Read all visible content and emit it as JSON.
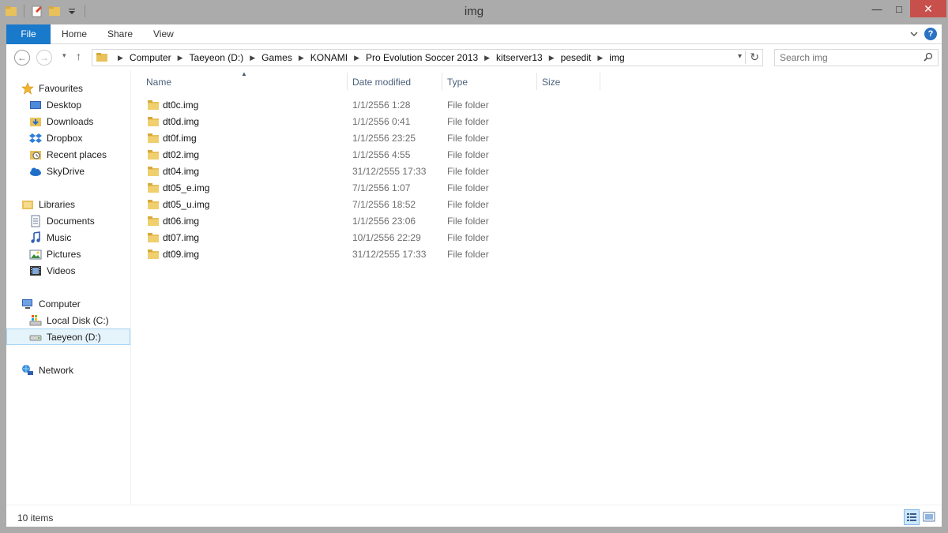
{
  "window": {
    "title": "img",
    "buttons": {
      "minimize": "—",
      "maximize": "□",
      "close": "✕"
    }
  },
  "ribbon": {
    "tabs": [
      "File",
      "Home",
      "Share",
      "View"
    ],
    "help": "?"
  },
  "address": {
    "crumbs": [
      "Computer",
      "Taeyeon (D:)",
      "Games",
      "KONAMI",
      "Pro Evolution Soccer 2013",
      "kitserver13",
      "pesedit",
      "img"
    ]
  },
  "search": {
    "placeholder": "Search img"
  },
  "nav": {
    "favourites": {
      "label": "Favourites",
      "items": [
        "Desktop",
        "Downloads",
        "Dropbox",
        "Recent places",
        "SkyDrive"
      ]
    },
    "libraries": {
      "label": "Libraries",
      "items": [
        "Documents",
        "Music",
        "Pictures",
        "Videos"
      ]
    },
    "computer": {
      "label": "Computer",
      "items": [
        "Local Disk (C:)",
        "Taeyeon (D:)"
      ],
      "selected": "Taeyeon (D:)"
    },
    "network": {
      "label": "Network"
    }
  },
  "columns": {
    "name": "Name",
    "date": "Date modified",
    "type": "Type",
    "size": "Size"
  },
  "files": [
    {
      "name": "dt0c.img",
      "date": "1/1/2556 1:28",
      "type": "File folder",
      "size": ""
    },
    {
      "name": "dt0d.img",
      "date": "1/1/2556 0:41",
      "type": "File folder",
      "size": ""
    },
    {
      "name": "dt0f.img",
      "date": "1/1/2556 23:25",
      "type": "File folder",
      "size": ""
    },
    {
      "name": "dt02.img",
      "date": "1/1/2556 4:55",
      "type": "File folder",
      "size": ""
    },
    {
      "name": "dt04.img",
      "date": "31/12/2555 17:33",
      "type": "File folder",
      "size": ""
    },
    {
      "name": "dt05_e.img",
      "date": "7/1/2556 1:07",
      "type": "File folder",
      "size": ""
    },
    {
      "name": "dt05_u.img",
      "date": "7/1/2556 18:52",
      "type": "File folder",
      "size": ""
    },
    {
      "name": "dt06.img",
      "date": "1/1/2556 23:06",
      "type": "File folder",
      "size": ""
    },
    {
      "name": "dt07.img",
      "date": "10/1/2556 22:29",
      "type": "File folder",
      "size": ""
    },
    {
      "name": "dt09.img",
      "date": "31/12/2555 17:33",
      "type": "File folder",
      "size": ""
    }
  ],
  "status": {
    "count": "10 items"
  },
  "colors": {
    "file_tab": "#1979ca",
    "folder": "#e8c15a",
    "selection": "#e5f3fb",
    "close": "#c7504c"
  }
}
